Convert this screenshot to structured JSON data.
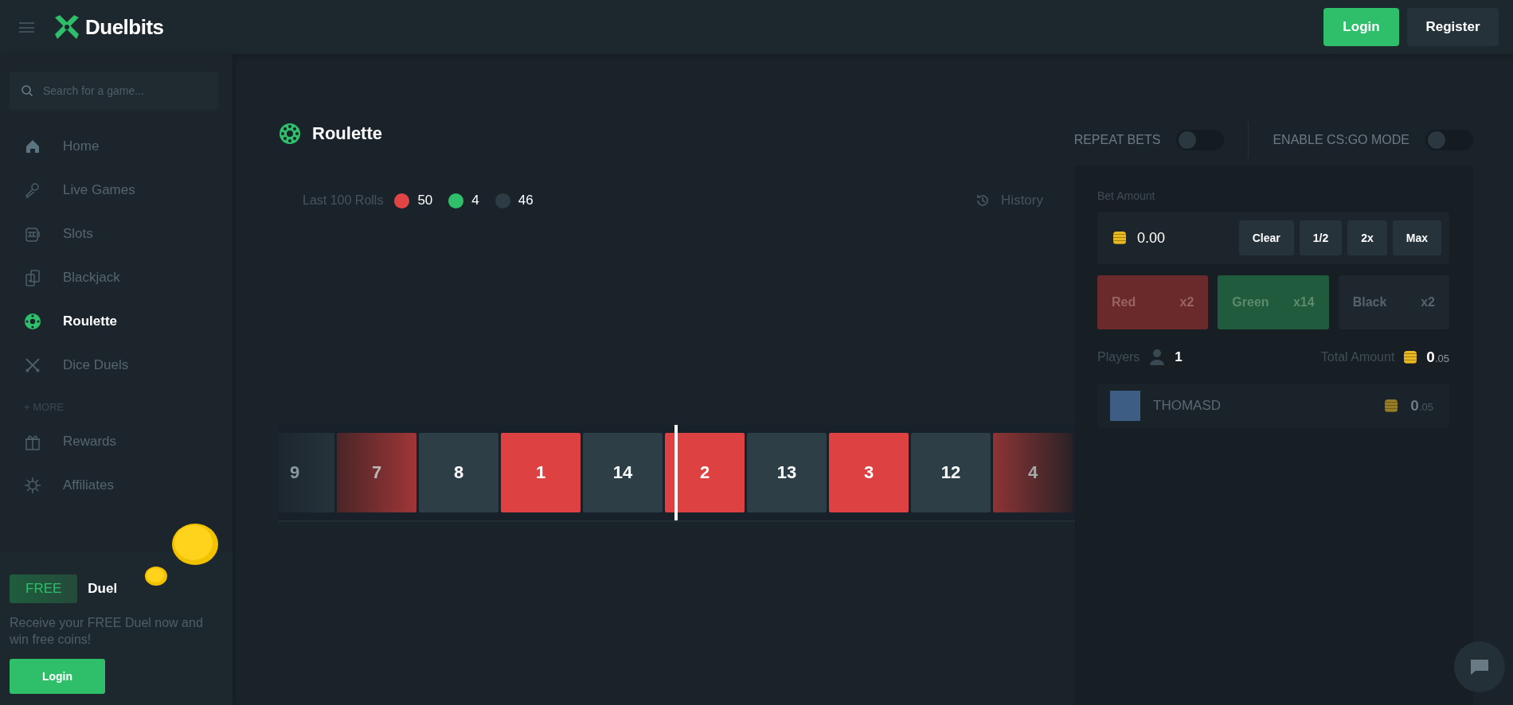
{
  "header": {
    "logo": "Duelbits",
    "buttons": [
      {
        "label": "Login",
        "kind": "primary"
      },
      {
        "label": "Register",
        "kind": "secondary"
      }
    ]
  },
  "sidebar": {
    "search": {
      "placeholder": "Search for a game..."
    },
    "items": [
      {
        "label": "Home",
        "selected": false
      },
      {
        "label": "Live Games",
        "selected": false
      },
      {
        "label": "Slots",
        "selected": false
      },
      {
        "label": "Blackjack",
        "selected": false
      },
      {
        "label": "Roulette",
        "selected": true
      },
      {
        "label": "Dice Duels",
        "selected": false
      }
    ],
    "more_label": "+ MORE",
    "more_items": [
      {
        "label": "Rewards",
        "selected": false
      },
      {
        "label": "Affiliates",
        "selected": false
      }
    ],
    "promo": {
      "badge": "FREE",
      "title": "Duel",
      "text": "Receive your FREE Duel now and win free coins!",
      "button": "Login"
    }
  },
  "game": {
    "title": "Roulette",
    "toggles": [
      {
        "label": "REPEAT BETS",
        "on": false
      },
      {
        "label": "ENABLE CS:GO MODE",
        "on": false
      }
    ],
    "rolls_label": "Last 100 Rolls",
    "rolls": [
      {
        "count": "50",
        "color": "#e04444"
      },
      {
        "count": "4",
        "color": "#2fbf6b"
      },
      {
        "count": "46",
        "color": "#2c3b44"
      }
    ],
    "history": "History",
    "tiles": [
      {
        "number": "9",
        "kind": "black"
      },
      {
        "number": "7",
        "kind": "red"
      },
      {
        "number": "8",
        "kind": "black"
      },
      {
        "number": "1",
        "kind": "red"
      },
      {
        "number": "14",
        "kind": "black"
      },
      {
        "number": "2",
        "kind": "red"
      },
      {
        "number": "13",
        "kind": "black"
      },
      {
        "number": "3",
        "kind": "red"
      },
      {
        "number": "12",
        "kind": "black"
      },
      {
        "number": "4",
        "kind": "red"
      }
    ]
  },
  "bet_panel": {
    "label": "Bet Amount",
    "amount": "0.00",
    "quick_buttons": [
      "Clear",
      "1/2",
      "2x",
      "Max"
    ],
    "color_bets": [
      {
        "label": "Red",
        "multiplier": "x2",
        "kind": "red"
      },
      {
        "label": "Green",
        "multiplier": "x14",
        "kind": "green"
      },
      {
        "label": "Black",
        "multiplier": "x2",
        "kind": "black"
      }
    ],
    "players_label": "Players",
    "players_count": "1",
    "total_label": "Total Amount",
    "total_whole": "0",
    "total_fraction": ".05",
    "players": [
      {
        "name": "THOMASD",
        "amount_whole": "0",
        "amount_fraction": ".05"
      }
    ]
  }
}
